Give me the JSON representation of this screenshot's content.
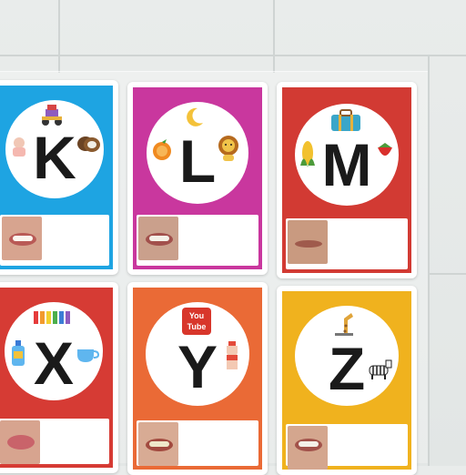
{
  "cards": [
    {
      "letter": "K",
      "color": "#1ea4e2",
      "mouth": "open"
    },
    {
      "letter": "L",
      "color": "#c9379e",
      "mouth": "teeth"
    },
    {
      "letter": "M",
      "color": "#d23a33",
      "mouth": "closed"
    },
    {
      "letter": "X",
      "color": "#d63b34",
      "mouth": "open"
    },
    {
      "letter": "Y",
      "color": "#ea6a36",
      "mouth": "teeth"
    },
    {
      "letter": "Z",
      "color": "#f0b21e",
      "mouth": "teeth"
    }
  ],
  "stickers": {
    "y_logo": {
      "line1": "You",
      "line2": "Tube"
    }
  },
  "icons": [
    "robot-toy-icon",
    "coconut-icon",
    "doll-icon",
    "moon-icon",
    "orange-icon",
    "lion-icon",
    "suitcase-icon",
    "corn-icon",
    "strawberry-icon",
    "xylophone-icon",
    "bottle-icon",
    "cup-icon",
    "youtube-icon",
    "yakult-bottle-icon",
    "giraffe-icon",
    "zebra-icon"
  ]
}
